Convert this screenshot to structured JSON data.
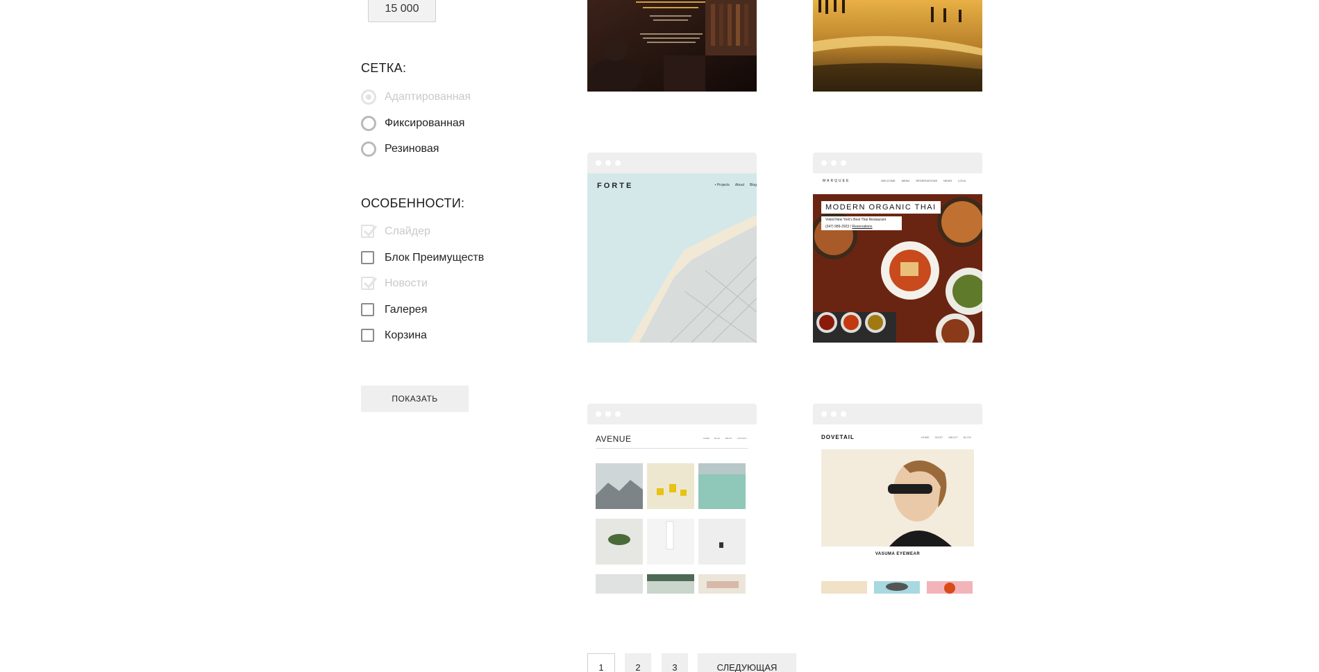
{
  "price": {
    "value": "15 000"
  },
  "grid": {
    "title": "СЕТКА:",
    "options": [
      {
        "label": "Адаптированная",
        "disabled": true
      },
      {
        "label": "Фиксированная",
        "disabled": false
      },
      {
        "label": "Резиновая",
        "disabled": false
      }
    ]
  },
  "features": {
    "title": "ОСОБЕННОСТИ:",
    "options": [
      {
        "label": "Слайдер",
        "disabled": true,
        "checked": true
      },
      {
        "label": "Блок Преимуществ",
        "disabled": false,
        "checked": false
      },
      {
        "label": "Новости",
        "disabled": true,
        "checked": true
      },
      {
        "label": "Галерея",
        "disabled": false,
        "checked": false
      },
      {
        "label": "Корзина",
        "disabled": false,
        "checked": false
      }
    ]
  },
  "show_button": "ПОКАЗАТЬ",
  "templates": {
    "forte": {
      "logo": "FORTE",
      "nav": [
        "• Projects",
        "About",
        "Blog"
      ]
    },
    "marquee": {
      "logo": "MARQUEE",
      "nav": [
        "WELCOME",
        "MENU",
        "RESERVATIONS",
        "NEWS",
        "LOCA"
      ],
      "headline": "MODERN ORGANIC THAI",
      "subline": "Voted New York's Best Thai Restaurant",
      "phone": "(347) 989-2923",
      "link": "Reservations"
    },
    "avenue": {
      "logo": "AVENUE",
      "nav": [
        "HOME",
        "BLOG",
        "ABOUT",
        "CONTACT"
      ]
    },
    "dovetail": {
      "logo": "DOVETAIL",
      "nav": [
        "HOME",
        "SHOP",
        "ABOUT",
        "BLOG"
      ],
      "caption": "VASUMA EYEWEAR"
    }
  },
  "pagination": {
    "pages": [
      "1",
      "2",
      "3"
    ],
    "next": "СЛЕДУЮЩАЯ",
    "current": "1"
  },
  "colors": {
    "accent_gray": "#efefef",
    "text": "#222222",
    "disabled": "#c9c9c9"
  }
}
